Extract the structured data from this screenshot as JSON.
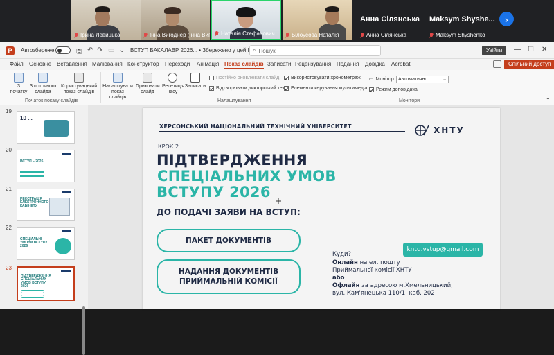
{
  "participants": [
    {
      "name": "Ірина Левицька",
      "muted": true
    },
    {
      "name": "Інна Вигоднер (Інна Вигодн...",
      "muted": true
    },
    {
      "name": "Наталія Стефанович",
      "muted": true
    },
    {
      "name": "Білоусова Наталія",
      "muted": true
    }
  ],
  "name_cards": [
    {
      "display": "Анна Сілянська",
      "label": "Анна Сілянська"
    },
    {
      "display": "Maksym Shyshe...",
      "label": "Maksym Shyshenko"
    }
  ],
  "titlebar": {
    "app_letter": "P",
    "autosave_label": "Автозбереження",
    "file_title": "ВСТУП БАКАЛАВР 2026... • Збережено у цей ПК ⌄",
    "search_placeholder": "Пошук",
    "signin_label": "Увійти",
    "minimize": "—",
    "restore": "☐",
    "close": "✕"
  },
  "menu": {
    "items": [
      "Файл",
      "Основне",
      "Вставлення",
      "Малювання",
      "Конструктор",
      "Переходи",
      "Анімація",
      "Показ слайдів",
      "Записати",
      "Рецензування",
      "Подання",
      "Довідка",
      "Acrobat"
    ],
    "active": "Показ слайдів",
    "share_label": "Спільний доступ"
  },
  "ribbon": {
    "btn_from_start": "З початку",
    "btn_from_current": "З поточного слайда",
    "btn_custom": "Користувацький показ слайдів",
    "group_start": "Початок показу слайдів",
    "btn_setup": "Налаштувати показ слайдів",
    "btn_hide": "Приховати слайд",
    "btn_rehearse": "Репетиція часу",
    "btn_record": "Записати",
    "chk_update": "Постійно оновлювати слайд",
    "chk_narration": "Відтворювати дикторський текст",
    "chk_timings": "Використовувати хронометраж",
    "chk_controls": "Елементи керування мультимедіа",
    "group_setup": "Налаштування",
    "monitor_label": "Монітор:",
    "monitor_value": "Автоматично",
    "presenter_view": "Режим доповідача",
    "group_monitors": "Монітори"
  },
  "thumbnails": [
    {
      "num": "19",
      "text": "10 ..."
    },
    {
      "num": "20",
      "text": "ВСТУП – 2026"
    },
    {
      "num": "21",
      "text": "РЕЄСТРАЦІЯ ЕЛЕКТРОННОГО КАБІНЕТУ"
    },
    {
      "num": "22",
      "text": "СПЕЦІАЛЬНІ УМОВИ ВСТУПУ 2026"
    },
    {
      "num": "23",
      "text": "ПІДТВЕРДЖЕННЯ СПЕЦІАЛЬНИХ УМОВ ВСТУПУ 2026"
    }
  ],
  "slide": {
    "university": "ХЕРСОНСЬКИЙ НАЦІОНАЛЬНИЙ ТЕХНІЧНИЙ УНІВЕРСИТЕТ",
    "logo_text": "ХНТУ",
    "step": "КРОК 2",
    "title_line1": "ПІДТВЕРДЖЕННЯ",
    "title_line2": "СПЕЦІАЛЬНИХ УМОВ",
    "title_line3": "ВСТУПУ 2026",
    "subtitle": "ДО ПОДАЧІ ЗАЯВИ НА ВСТУП:",
    "pill1": "ПАКЕТ ДОКУМЕНТІВ",
    "pill2_line1": "НАДАННЯ ДОКУМЕНТІВ",
    "pill2_line2": "ПРИЙМАЛЬНІЙ КОМІСІЇ",
    "email": "kntu.vstup@gmail.com",
    "where": "Куди?",
    "online_bold": "Онлайн",
    "online_rest": " на ел. пошту",
    "online_line2": "Приймальної комісії ХНТУ",
    "or": "або",
    "offline_bold": "Офлайн",
    "offline_rest": " за адресою м.Хмельницький,",
    "offline_line2": "вул. Кам'янецька  110/1, каб. 202"
  },
  "colors": {
    "accent": "#c43e1c",
    "teal": "#2bb5a7",
    "navy": "#1f2a44"
  }
}
